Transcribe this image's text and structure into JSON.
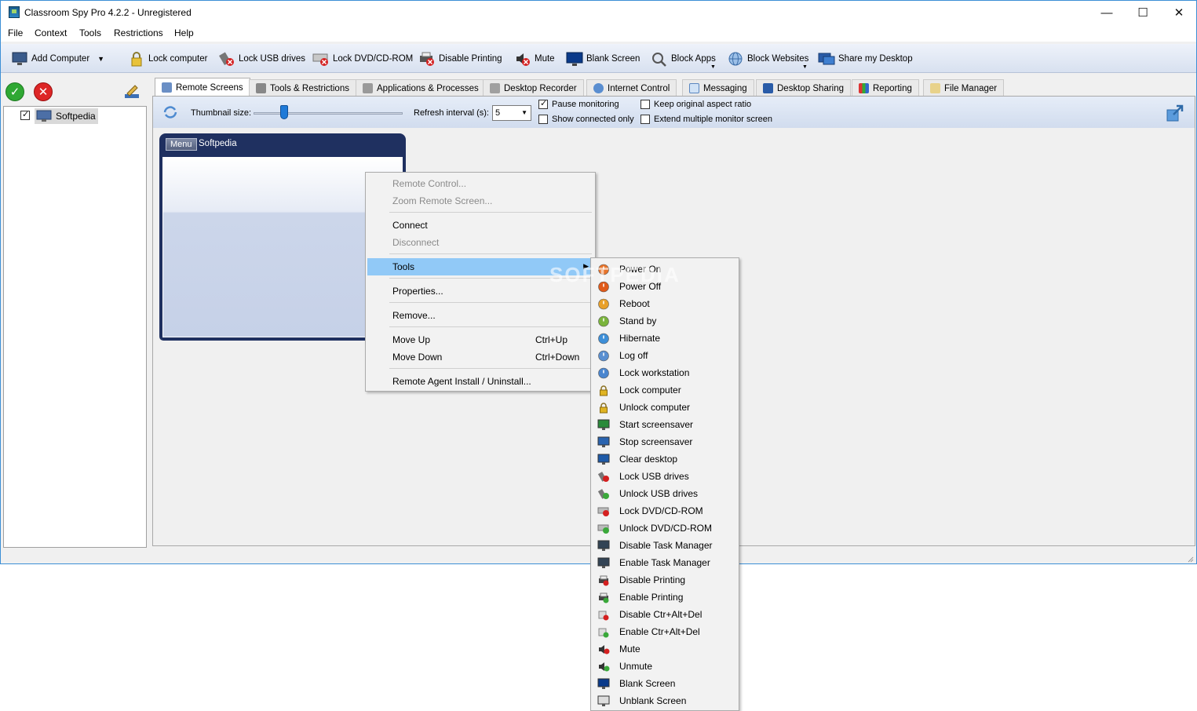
{
  "window": {
    "title": "Classroom Spy Pro 4.2.2 - Unregistered"
  },
  "menubar": [
    "File",
    "Context",
    "Tools",
    "Restrictions",
    "Help"
  ],
  "toolbar": {
    "add_computer": "Add Computer",
    "lock_computer": "Lock computer",
    "lock_usb": "Lock USB drives",
    "lock_dvd": "Lock DVD/CD-ROM",
    "disable_printing": "Disable Printing",
    "mute": "Mute",
    "blank_screen": "Blank Screen",
    "block_apps": "Block Apps",
    "block_websites": "Block Websites",
    "share_desktop": "Share my Desktop"
  },
  "tree": {
    "computer": "Softpedia",
    "checked": true
  },
  "tabs": [
    "Remote Screens",
    "Tools & Restrictions",
    "Applications & Processes",
    "Desktop Recorder",
    "Internet Control",
    "Messaging",
    "Desktop Sharing",
    "Reporting",
    "File Manager"
  ],
  "options": {
    "thumbnail_size_label": "Thumbnail size:",
    "refresh_label": "Refresh interval (s):",
    "refresh_value": "5",
    "pause_monitoring": "Pause monitoring",
    "pause_checked": true,
    "show_connected": "Show connected only",
    "show_connected_checked": false,
    "keep_aspect": "Keep original aspect ratio",
    "keep_aspect_checked": false,
    "extend_monitor": "Extend multiple monitor screen",
    "extend_monitor_checked": false
  },
  "thumbnail": {
    "menu_label": "Menu",
    "name": "Softpedia"
  },
  "context_menu": {
    "remote_control": "Remote Control...",
    "zoom_remote": "Zoom Remote Screen...",
    "connect": "Connect",
    "disconnect": "Disconnect",
    "tools": "Tools",
    "properties": "Properties...",
    "remove": "Remove...",
    "move_up": "Move Up",
    "move_up_key": "Ctrl+Up",
    "move_down": "Move Down",
    "move_down_key": "Ctrl+Down",
    "remote_agent": "Remote Agent Install / Uninstall..."
  },
  "tools_submenu": [
    "Power On",
    "Power Off",
    "Reboot",
    "Stand by",
    "Hibernate",
    "Log off",
    "Lock workstation",
    "Lock computer",
    "Unlock computer",
    "Start screensaver",
    "Stop screensaver",
    "Clear desktop",
    "Lock USB drives",
    "Unlock USB drives",
    "Lock DVD/CD-ROM",
    "Unlock DVD/CD-ROM",
    "Disable Task Manager",
    "Enable Task Manager",
    "Disable Printing",
    "Enable Printing",
    "Disable Ctr+Alt+Del",
    "Enable Ctr+Alt+Del",
    "Mute",
    "Unmute",
    "Blank Screen",
    "Unblank Screen"
  ],
  "watermark": "SOFTPEDIA"
}
